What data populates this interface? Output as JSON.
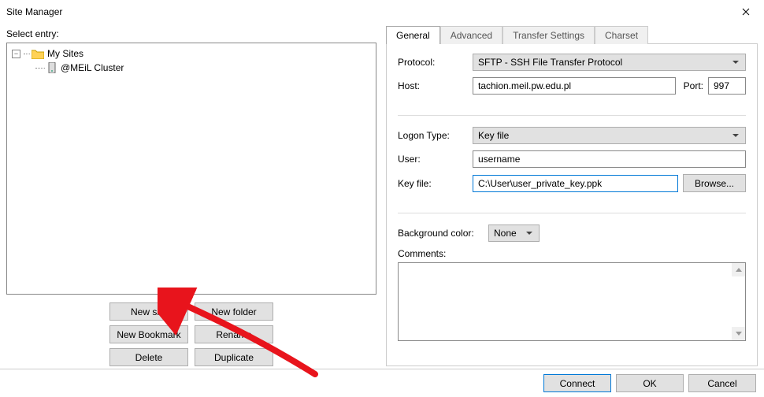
{
  "title": "Site Manager",
  "leftPane": {
    "selectEntryLabel": "Select entry:",
    "tree": {
      "root": "My Sites",
      "child": "@MEiL Cluster"
    },
    "buttons": {
      "newSite": "New site",
      "newFolder": "New folder",
      "newBookmark": "New Bookmark",
      "rename": "Rename",
      "delete": "Delete",
      "duplicate": "Duplicate"
    }
  },
  "tabs": {
    "general": "General",
    "advanced": "Advanced",
    "transfer": "Transfer Settings",
    "charset": "Charset"
  },
  "general": {
    "protocolLabel": "Protocol:",
    "protocolValue": "SFTP - SSH File Transfer Protocol",
    "hostLabel": "Host:",
    "hostValue": "tachion.meil.pw.edu.pl",
    "portLabel": "Port:",
    "portValue": "997",
    "logonTypeLabel": "Logon Type:",
    "logonTypeValue": "Key file",
    "userLabel": "User:",
    "userValue": "username",
    "keyfileLabel": "Key file:",
    "keyfileValue": "C:\\User\\user_private_key.ppk",
    "browse": "Browse...",
    "bgColorLabel": "Background color:",
    "bgColorValue": "None",
    "commentsLabel": "Comments:"
  },
  "bottom": {
    "connect": "Connect",
    "ok": "OK",
    "cancel": "Cancel"
  }
}
